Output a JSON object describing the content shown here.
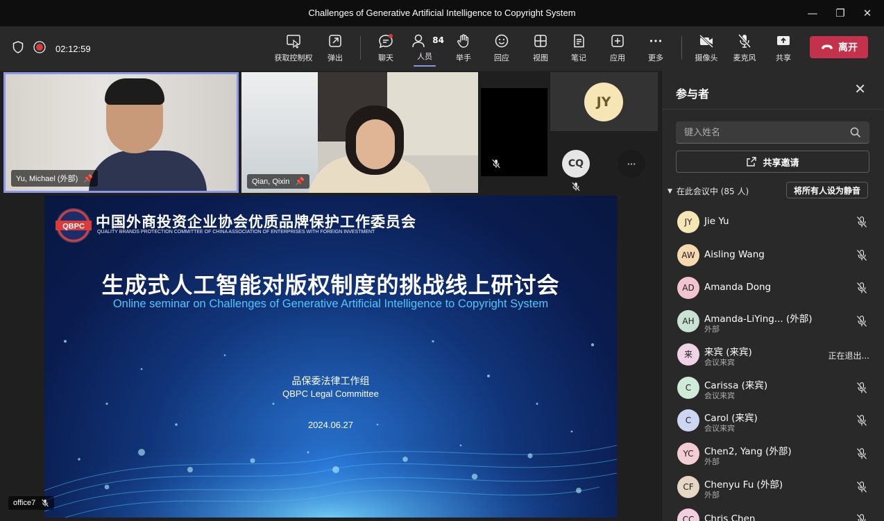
{
  "window": {
    "title": "Challenges of Generative Artificial Intelligence to Copyright System",
    "minimize_glyph": "—",
    "restore_glyph": "❐",
    "close_glyph": "✕"
  },
  "meeting": {
    "timer": "02:12:59"
  },
  "toolbar": {
    "take_control": "获取控制权",
    "pop_out": "弹出",
    "chat": "聊天",
    "people": "人员",
    "people_count": "84",
    "raise_hand": "举手",
    "react": "回应",
    "view": "视图",
    "notes": "笔记",
    "apps": "应用",
    "more": "更多",
    "camera": "摄像头",
    "mic": "麦克风",
    "share": "共享",
    "leave": "离开"
  },
  "videos": {
    "tile1_name": "Yu, Michael (外部)",
    "tile2_name": "Qian, Qixin",
    "avatar_jy": "JY",
    "avatar_cq": "CQ",
    "more_glyph": "···",
    "bottom_name": "office7"
  },
  "slide": {
    "logo_text": "QBPC",
    "org_cn": "中国外商投资企业协会优质品牌保护工作委员会",
    "org_en": "QUALITY BRANDS PROTECTION COMMITTEE OF CHINA ASSOCIATION OF ENTERPRISES WITH FOREIGN INVESTMENT",
    "title_cn": "生成式人工智能对版权制度的挑战线上研讨会",
    "title_en": "Online seminar on Challenges of Generative Artificial Intelligence to Copyright System",
    "sub_cn": "品保委法律工作组",
    "sub_en": "QBPC Legal Committee",
    "date": "2024.06.27"
  },
  "panel": {
    "title": "参与者",
    "close_glyph": "✕",
    "search_placeholder": "键入姓名",
    "share_invite": "共享邀请",
    "in_meeting": "在此会议中 (85 人)",
    "mute_all": "将所有人设为静音",
    "participants": [
      {
        "initials": "JY",
        "name": "Jie Yu",
        "sub": "",
        "color": "#f7e6b5",
        "status": ""
      },
      {
        "initials": "AW",
        "name": "Aisling Wang",
        "sub": "",
        "color": "#f7d9b0",
        "status": ""
      },
      {
        "initials": "AD",
        "name": "Amanda Dong",
        "sub": "",
        "color": "#f1c4cf",
        "status": ""
      },
      {
        "initials": "AH",
        "name": "Amanda-LiYing... (外部)",
        "sub": "外部",
        "color": "#c8e3d3",
        "status": ""
      },
      {
        "initials": "来",
        "name": "来宾 (来宾)",
        "sub": "会议来宾",
        "color": "#f0d3e7",
        "status": "正在退出..."
      },
      {
        "initials": "C",
        "name": "Carissa (来宾)",
        "sub": "会议来宾",
        "color": "#cdebd6",
        "status": ""
      },
      {
        "initials": "C",
        "name": "Carol (来宾)",
        "sub": "会议来宾",
        "color": "#cdd6f0",
        "status": ""
      },
      {
        "initials": "YC",
        "name": "Chen2, Yang (外部)",
        "sub": "外部",
        "color": "#f3cdd3",
        "status": ""
      },
      {
        "initials": "CF",
        "name": "Chenyu Fu (外部)",
        "sub": "外部",
        "color": "#e6d6c4",
        "status": ""
      },
      {
        "initials": "CC",
        "name": "Chris Chen",
        "sub": "",
        "color": "#f1cfe0",
        "status": ""
      }
    ]
  },
  "colors": {
    "accent": "#8e96e6",
    "leave": "#c4314b",
    "record": "#d83b3b",
    "panel_bg": "#292929",
    "toolbar_bg": "#292929"
  }
}
